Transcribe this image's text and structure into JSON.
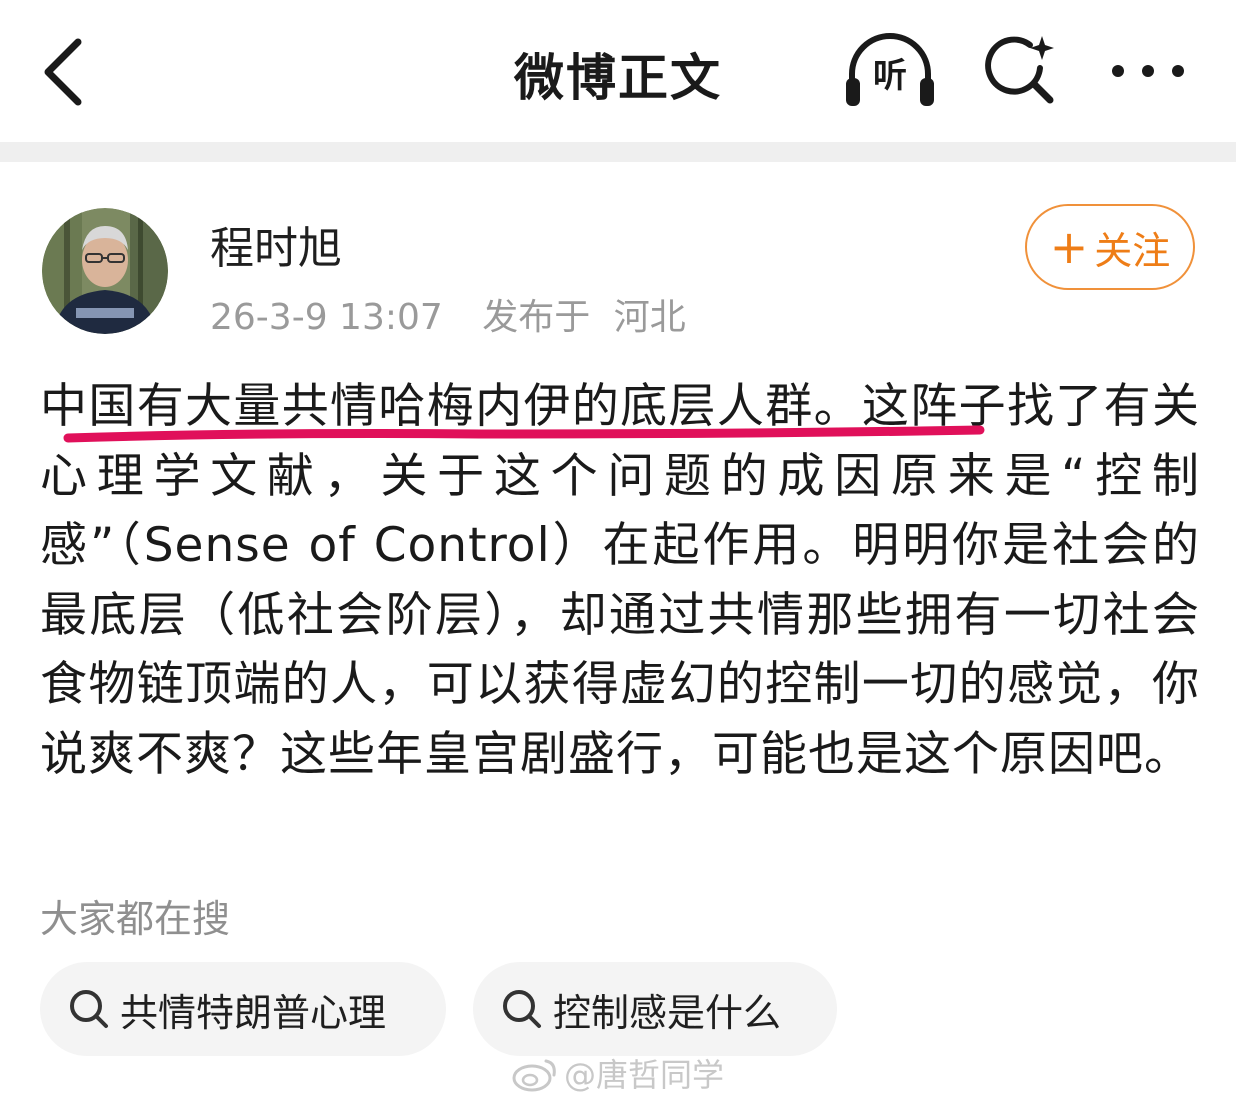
{
  "header": {
    "title": "微博正文",
    "listen_label": "听",
    "back_icon": "back-chevron-icon",
    "search_icon": "ai-search-icon",
    "more_icon": "more-dots-icon"
  },
  "post": {
    "author": {
      "name": "程时旭",
      "avatar_icon": "user-avatar"
    },
    "timestamp": "26-3-9 13:07",
    "location_label": "发布于",
    "location": "河北",
    "follow_label": "关注",
    "follow_plus": "+",
    "body": "中国有大量共情哈梅内伊的底层人群。这阵子找了有关心理学文献，关于这个问题的成因原来是“控制感”（Sense of Control）在起作用。明明你是社会的最底层（低社会阶层），却通过共情那些拥有一切社会食物链顶端的人，可以获得虚幻的控制一切的感觉，你说爽不爽？这些年皇宫剧盛行，可能也是这个原因吧。"
  },
  "trending": {
    "title": "大家都在搜",
    "chips": [
      {
        "label": "共情特朗普心理",
        "icon": "search-icon"
      },
      {
        "label": "控制感是什么",
        "icon": "search-icon"
      }
    ]
  },
  "watermark": {
    "text": "@唐哲同学",
    "icon": "weibo-logo-icon"
  },
  "colors": {
    "accent_orange": "#ee7d17",
    "highlight_stroke": "#e0105a",
    "muted_text": "#9a9a9a",
    "chip_bg": "#f4f4f4",
    "divider": "#efefef"
  }
}
